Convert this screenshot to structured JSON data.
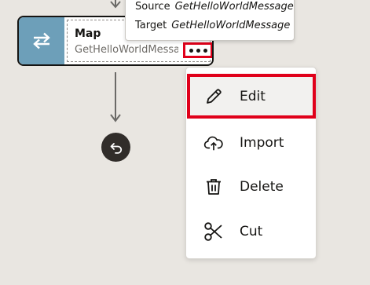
{
  "node": {
    "title": "Map",
    "subtitle": "GetHelloWorldMessage",
    "more_label": "More actions"
  },
  "tooltip": {
    "source_label": "Source",
    "source_value": "GetHelloWorldMessage",
    "target_label": "Target",
    "target_value": "GetHelloWorldMessage"
  },
  "context_menu": {
    "items": [
      {
        "label": "Edit",
        "icon": "pencil-icon"
      },
      {
        "label": "Import",
        "icon": "cloud-upload-icon"
      },
      {
        "label": "Delete",
        "icon": "trash-icon"
      },
      {
        "label": "Cut",
        "icon": "scissors-icon"
      }
    ]
  },
  "colors": {
    "canvas_bg": "#e9e6e1",
    "map_icon_bg": "#6d9fb9",
    "highlight_border": "#e0001a",
    "loop_button_bg": "#312d2a"
  },
  "icons": {
    "node_icon": "swap-arrows-icon",
    "loop_icon": "undo-icon"
  }
}
